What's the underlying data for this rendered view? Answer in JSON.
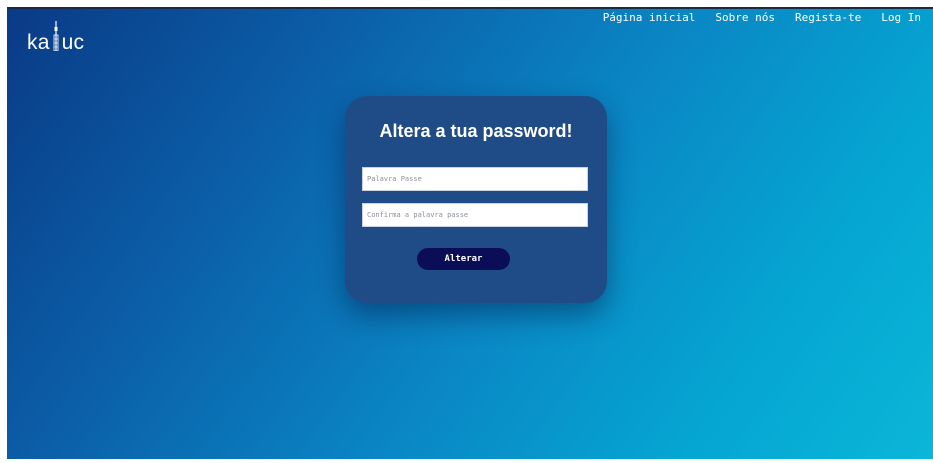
{
  "logo": {
    "text_left": "ka",
    "text_right": "uc",
    "icon": "tower-icon"
  },
  "nav": {
    "items": [
      {
        "label": "Página inicial"
      },
      {
        "label": "Sobre nós"
      },
      {
        "label": "Regista-te"
      },
      {
        "label": "Log In"
      }
    ]
  },
  "form": {
    "title": "Altera a tua password!",
    "password_placeholder": "Palavra Passe",
    "confirm_placeholder": "Confirma a palavra passe",
    "password_value": "",
    "confirm_value": "",
    "submit_label": "Alterar"
  },
  "colors": {
    "card": "#1f4b86",
    "button": "#0b0e57",
    "text": "#ffffff"
  }
}
